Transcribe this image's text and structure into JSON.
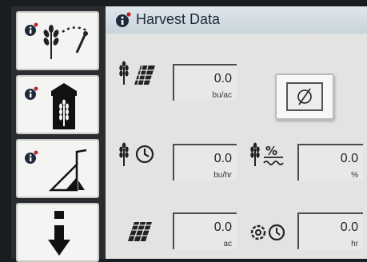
{
  "title": "Harvest Data",
  "sidebar": {
    "buttons": [
      {
        "name": "harvest-monitor-button",
        "icon": "grain-sensor-icon"
      },
      {
        "name": "grain-tank-button",
        "icon": "grain-tank-icon"
      },
      {
        "name": "header-button",
        "icon": "header-height-icon"
      },
      {
        "name": "page-down-button",
        "icon": "arrow-down-icon"
      }
    ]
  },
  "reset": {
    "label": "Ø"
  },
  "fields": {
    "yield": {
      "value": "0.0",
      "unit": "bu/ac"
    },
    "harvest_rate": {
      "value": "0.0",
      "unit": "bu/hr"
    },
    "moisture": {
      "value": "0.0",
      "unit": "%"
    },
    "area": {
      "value": "0.0",
      "unit": "ac"
    },
    "engine_hours": {
      "value": "0.0",
      "unit": "hr"
    }
  },
  "colors": {
    "accent": "#1c2a3a",
    "panel": "#dfe1df",
    "info_red": "#c41e1e"
  }
}
